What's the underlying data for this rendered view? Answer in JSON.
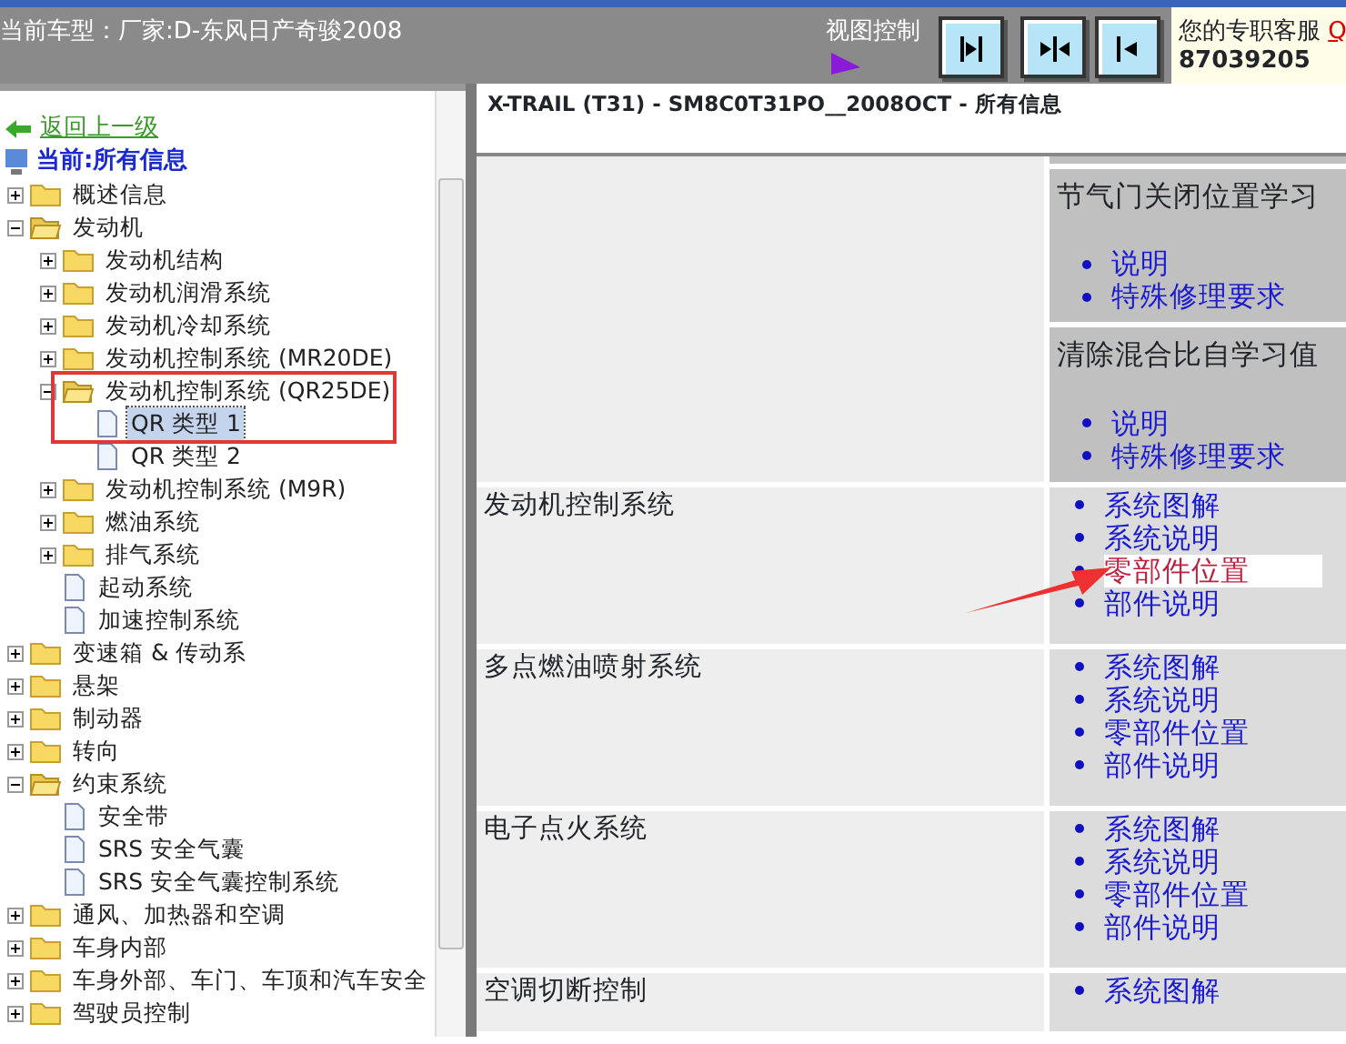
{
  "top_bar": {
    "vehicle": "当前车型：厂家:D-东风日产奇骏2008",
    "view_control": "视图控制",
    "view_buttons": [
      {
        "kind": "right"
      },
      {
        "kind": "both"
      },
      {
        "kind": "left"
      }
    ],
    "service_label": "您的专职客服",
    "service_link": "Q",
    "service_number": "87039205"
  },
  "sidebar": {
    "back_link": "返回上一级",
    "current": "当前:所有信息",
    "tree": [
      {
        "label": "概述信息",
        "kind": "folder",
        "expanded": false
      },
      {
        "label": "发动机",
        "kind": "folder",
        "expanded": true,
        "children": [
          {
            "label": "发动机结构",
            "kind": "folder",
            "expanded": false
          },
          {
            "label": "发动机润滑系统",
            "kind": "folder",
            "expanded": false
          },
          {
            "label": "发动机冷却系统",
            "kind": "folder",
            "expanded": false
          },
          {
            "label": "发动机控制系统 (MR20DE)",
            "kind": "folder",
            "expanded": false
          },
          {
            "label": "发动机控制系统 (QR25DE)",
            "kind": "folder",
            "expanded": true,
            "highlighted": true,
            "children": [
              {
                "label": "QR 类型  1",
                "kind": "page",
                "selected": true
              },
              {
                "label": "QR 类型  2",
                "kind": "page",
                "selected": false
              }
            ]
          },
          {
            "label": "发动机控制系统 (M9R)",
            "kind": "folder",
            "expanded": false
          },
          {
            "label": "燃油系统",
            "kind": "folder",
            "expanded": false
          },
          {
            "label": "排气系统",
            "kind": "folder",
            "expanded": false
          },
          {
            "label": "起动系统",
            "kind": "page",
            "selected": false
          },
          {
            "label": "加速控制系统",
            "kind": "page",
            "selected": false
          }
        ]
      },
      {
        "label": "变速箱 & 传动系",
        "kind": "folder",
        "expanded": false
      },
      {
        "label": "悬架",
        "kind": "folder",
        "expanded": false
      },
      {
        "label": "制动器",
        "kind": "folder",
        "expanded": false
      },
      {
        "label": "转向",
        "kind": "folder",
        "expanded": false
      },
      {
        "label": "约束系统",
        "kind": "folder",
        "expanded": true,
        "children": [
          {
            "label": "安全带",
            "kind": "page",
            "selected": false
          },
          {
            "label": "SRS 安全气囊",
            "kind": "page",
            "selected": false
          },
          {
            "label": "SRS 安全气囊控制系统",
            "kind": "page",
            "selected": false
          }
        ]
      },
      {
        "label": "通风、加热器和空调",
        "kind": "folder",
        "expanded": false
      },
      {
        "label": "车身内部",
        "kind": "folder",
        "expanded": false
      },
      {
        "label": "车身外部、车门、车顶和汽车安全",
        "kind": "folder",
        "expanded": false
      },
      {
        "label": "驾驶员控制",
        "kind": "folder",
        "expanded": false
      }
    ]
  },
  "content": {
    "title": "X-TRAIL (T31) - SM8C0T31PO__2008OCT - 所有信息",
    "rows": [
      {
        "kind": "nested",
        "sections": [
          {
            "heading": "节气门关闭位置学习",
            "links": [
              {
                "text": "说明",
                "selected": false
              },
              {
                "text": "特殊修理要求",
                "selected": false
              }
            ]
          },
          {
            "heading": "清除混合比自学习值",
            "links": [
              {
                "text": "说明",
                "selected": false
              },
              {
                "text": "特殊修理要求",
                "selected": false
              }
            ]
          }
        ]
      },
      {
        "kind": "links",
        "label": "发动机控制系统",
        "links": [
          {
            "text": "系统图解",
            "selected": false
          },
          {
            "text": "系统说明",
            "selected": false
          },
          {
            "text": "零部件位置",
            "selected": true
          },
          {
            "text": "部件说明",
            "selected": false
          }
        ]
      },
      {
        "kind": "links",
        "label": "多点燃油喷射系统",
        "links": [
          {
            "text": "系统图解",
            "selected": false
          },
          {
            "text": "系统说明",
            "selected": false
          },
          {
            "text": "零部件位置",
            "selected": false
          },
          {
            "text": "部件说明",
            "selected": false
          }
        ]
      },
      {
        "kind": "links",
        "label": "电子点火系统",
        "links": [
          {
            "text": "系统图解",
            "selected": false
          },
          {
            "text": "系统说明",
            "selected": false
          },
          {
            "text": "零部件位置",
            "selected": false
          },
          {
            "text": "部件说明",
            "selected": false
          }
        ]
      },
      {
        "kind": "links",
        "label": "空调切断控制",
        "links": [
          {
            "text": "系统图解",
            "selected": false
          }
        ]
      }
    ]
  }
}
